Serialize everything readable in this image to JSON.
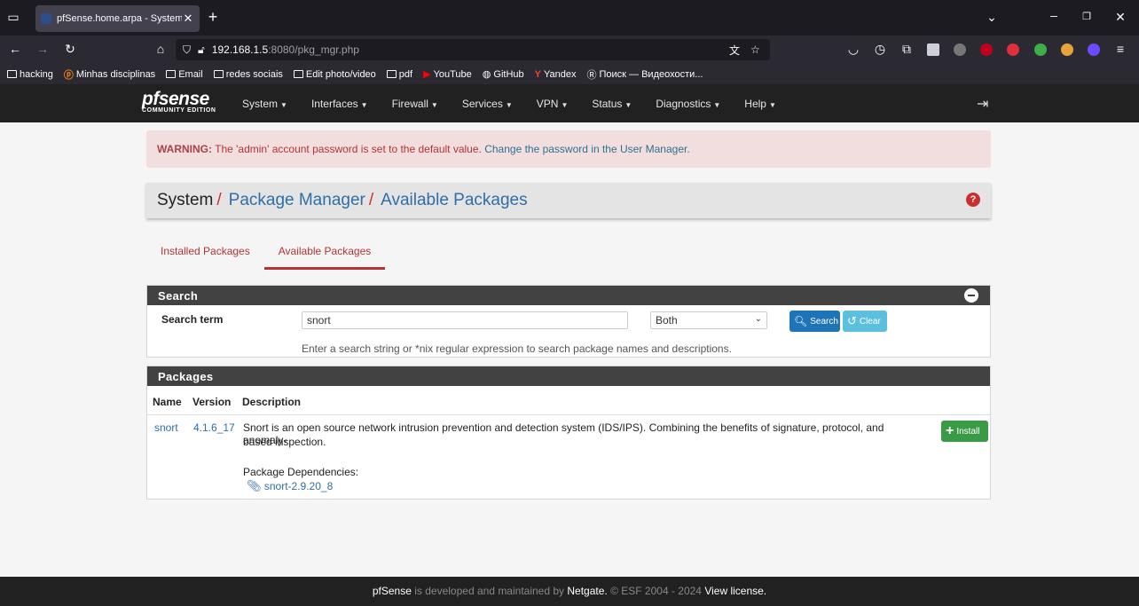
{
  "browser": {
    "tab_title": "pfSense.home.arpa - System: Pa",
    "url_host": "192.168.1.5",
    "url_path": ":8080/pkg_mgr.php",
    "bookmarks": [
      {
        "label": "hacking",
        "icon": "folder"
      },
      {
        "label": "Minhas disciplinas",
        "icon": "moodle"
      },
      {
        "label": "Email",
        "icon": "folder"
      },
      {
        "label": "redes sociais",
        "icon": "folder"
      },
      {
        "label": "Edit photo/video",
        "icon": "folder"
      },
      {
        "label": "pdf",
        "icon": "folder"
      },
      {
        "label": "YouTube",
        "icon": "youtube"
      },
      {
        "label": "GitHub",
        "icon": "github"
      },
      {
        "label": "Yandex",
        "icon": "yandex"
      },
      {
        "label": "Поиск — Видеохости...",
        "icon": "search"
      }
    ]
  },
  "header": {
    "logo": "pfsense",
    "logo_sub": "COMMUNITY EDITION",
    "menu": [
      "System",
      "Interfaces",
      "Firewall",
      "Services",
      "VPN",
      "Status",
      "Diagnostics",
      "Help"
    ]
  },
  "warning": {
    "prefix": "WARNING:",
    "text": " The 'admin' account password is set to the default value. ",
    "link": "Change the password in the User Manager."
  },
  "breadcrumb": {
    "root": "System",
    "level1": "Package Manager",
    "level2": "Available Packages",
    "sep": "/"
  },
  "tabs": [
    "Installed Packages",
    "Available Packages"
  ],
  "search": {
    "heading": "Search",
    "label": "Search term",
    "value": "snort",
    "scope": "Both",
    "search_button": "Search",
    "clear_button": "Clear",
    "help": "Enter a search string or *nix regular expression to search package names and descriptions."
  },
  "packages": {
    "heading": "Packages",
    "columns": [
      "Name",
      "Version",
      "Description"
    ],
    "rows": [
      {
        "name": "snort",
        "version": "4.1.6_17",
        "description_line1": "Snort is an open source network intrusion prevention and detection system (IDS/IPS). Combining the benefits of signature, protocol, and anomaly-",
        "description_line2": "based inspection.",
        "dependencies_label": "Package Dependencies:",
        "dependency": "snort-2.9.20_8",
        "install_button": "Install"
      }
    ]
  },
  "footer": {
    "brand": "pfSense",
    "middle": " is developed and maintained by ",
    "company": "Netgate.",
    "copyright": " © ESF 2004 - 2024 ",
    "license": "View license."
  },
  "colors": {
    "accent_red": "#b53333",
    "link_blue": "#2f6ea6",
    "install_green": "#3a9a46",
    "search_blue": "#1e74b8"
  }
}
